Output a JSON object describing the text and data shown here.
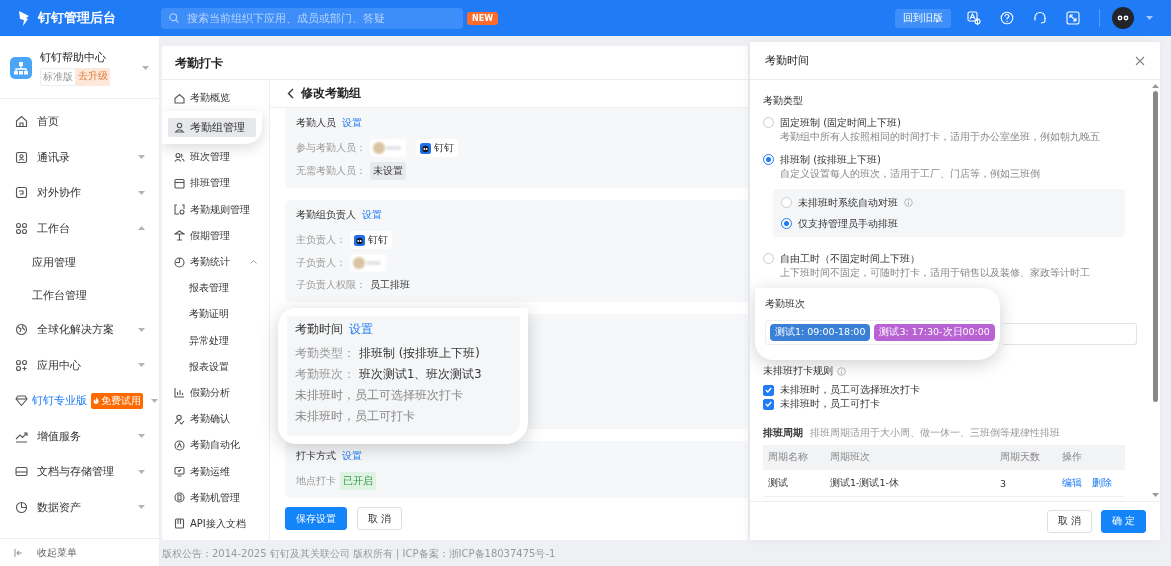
{
  "topbar": {
    "title": "钉钉管理后台",
    "search_placeholder": "搜索当前组织下应用、成员或部门、答疑",
    "new_badge": "NEW",
    "old_version_button": "回到旧版"
  },
  "sidebar": {
    "org": {
      "name": "钉钉帮助中心",
      "edition": "标准版",
      "upgrade": "去升级"
    },
    "items": [
      {
        "label": "首页",
        "kind": "link"
      },
      {
        "label": "通讯录",
        "kind": "group",
        "expanded": false
      },
      {
        "label": "对外协作",
        "kind": "group",
        "expanded": false
      },
      {
        "label": "工作台",
        "kind": "group",
        "expanded": true,
        "children": [
          {
            "label": "应用管理"
          },
          {
            "label": "工作台管理"
          }
        ]
      },
      {
        "label": "全球化解决方案",
        "kind": "group",
        "expanded": false
      },
      {
        "label": "应用中心",
        "kind": "group",
        "expanded": false
      },
      {
        "label": "钉钉专业版",
        "kind": "promo",
        "expanded": false,
        "badge": "免费试用"
      },
      {
        "label": "增值服务",
        "kind": "group",
        "expanded": false
      },
      {
        "label": "文档与存储管理",
        "kind": "group",
        "expanded": false
      },
      {
        "label": "数据资产",
        "kind": "group",
        "expanded": false
      }
    ],
    "collapse": "收起菜单"
  },
  "page": {
    "title": "考勤打卡",
    "submenu": [
      {
        "label": "考勤概览",
        "selected": false
      },
      {
        "label": "考勤组管理",
        "selected": true
      },
      {
        "label": "班次管理",
        "selected": false
      },
      {
        "label": "排班管理",
        "selected": false
      },
      {
        "label": "考勤规则管理",
        "selected": false
      },
      {
        "label": "假期管理",
        "selected": false
      },
      {
        "label": "考勤统计",
        "selected": false,
        "expanded": true,
        "children": [
          {
            "label": "报表管理"
          },
          {
            "label": "考勤证明"
          },
          {
            "label": "异常处理"
          },
          {
            "label": "报表设置"
          }
        ]
      },
      {
        "label": "假勤分析",
        "selected": false
      },
      {
        "label": "考勤确认",
        "selected": false
      },
      {
        "label": "考勤自动化",
        "selected": false
      },
      {
        "label": "考勤运维",
        "selected": false
      },
      {
        "label": "考勤机管理",
        "selected": false
      },
      {
        "label": "API接入文档",
        "selected": false
      }
    ],
    "form": {
      "title": "修改考勤组",
      "sections": [
        {
          "kind": "card",
          "title": "考勤人员",
          "link": "设置",
          "rows": [
            {
              "kind": "people",
              "label": "参与考勤人员：",
              "value": "钉钉"
            },
            {
              "kind": "tag",
              "label": "无需考勤人员：",
              "value": "未设置"
            }
          ]
        },
        {
          "kind": "card",
          "title": "考勤组负责人",
          "link": "设置",
          "rows": [
            {
              "kind": "user",
              "label": "主负责人：",
              "value": "钉钉"
            },
            {
              "kind": "blurred",
              "label": "子负责人："
            },
            {
              "kind": "text",
              "label": "子负责人权限：",
              "value": "员工排班"
            }
          ]
        },
        {
          "kind": "zoomed",
          "title": "考勤时间",
          "link": "设置",
          "rows": [
            {
              "kind": "text",
              "label": "考勤类型：",
              "value": "排班制 (按排班上下班)"
            },
            {
              "kind": "text",
              "label": "考勤班次：",
              "value": "班次测试1、班次测试3"
            },
            {
              "kind": "note",
              "value": "未排班时，员工可选择班次打卡"
            },
            {
              "kind": "note",
              "value": "未排班时，员工可打卡"
            }
          ]
        },
        {
          "kind": "card",
          "title": "打卡方式",
          "link": "设置",
          "rows": [
            {
              "kind": "status",
              "label": "地点打卡",
              "value": "已开启"
            }
          ]
        }
      ],
      "buttons": [
        {
          "label": "保存设置",
          "kind": "primary"
        },
        {
          "label": "取 消",
          "kind": "default"
        }
      ]
    },
    "footer": "版权公告：2014-2025 钉钉及其关联公司 版权所有 | ICP备案：浙ICP备18037475号-1"
  },
  "drawer": {
    "title": "考勤时间",
    "type_label": "考勤类型",
    "types": [
      {
        "label": "固定班制 (固定时间上下班)",
        "description": "考勤组中所有人按照相同的时间打卡，适用于办公室坐班，例如朝九晚五",
        "selected": false
      },
      {
        "label": "排班制 (按排班上下班)",
        "description": "自定义设置每人的班次，适用于工厂、门店等，例如三班倒",
        "selected": true,
        "options": [
          {
            "label": "未排班时系统自动对班",
            "info": true,
            "selected": false
          },
          {
            "label": "仅支持管理员手动排班",
            "info": false,
            "selected": true
          }
        ]
      },
      {
        "label": "自由工时（不固定时间上下班）",
        "description": "上下班时间不固定，可随时打卡，适用于销售以及装修、家政等计时工",
        "selected": false
      }
    ],
    "shift_label": "考勤班次",
    "shifts": [
      {
        "label": "测试1: 09:00-18:00",
        "color": "#3a80d6"
      },
      {
        "label": "测试3: 17:30-次日00:00",
        "color": "#b862d4"
      }
    ],
    "rule_label": "未排班打卡规则",
    "rules": [
      {
        "label": "未排班时，员工可选择班次打卡",
        "checked": true
      },
      {
        "label": "未排班时，员工可打卡",
        "checked": true
      }
    ],
    "cycle_label": "排班周期",
    "cycle_hint": "排班周期适用于大小周、做一休一、三班倒等规律性排班",
    "table": {
      "columns": [
        "周期名称",
        "周期班次",
        "周期天数",
        "操作"
      ],
      "rows": [
        {
          "cells": [
            "测试",
            "测试1-测试1-休",
            "3"
          ],
          "actions": [
            "编辑",
            "删除"
          ]
        }
      ]
    },
    "buttons": [
      {
        "label": "取 消",
        "kind": "default"
      },
      {
        "label": "确 定",
        "kind": "primary"
      }
    ]
  }
}
